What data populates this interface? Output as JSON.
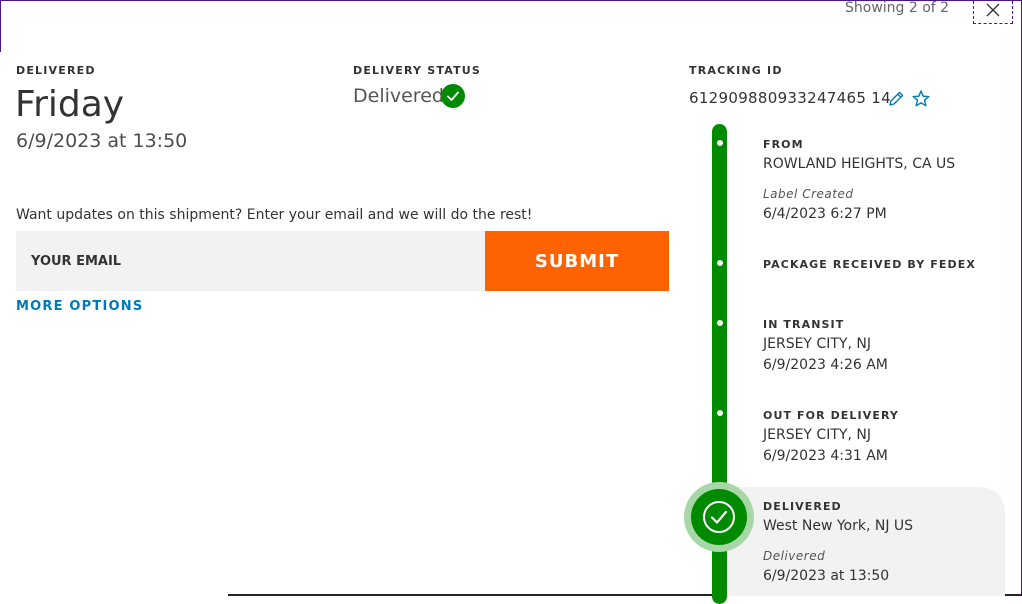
{
  "header": {
    "showing": "Showing 2 of 2",
    "close_icon": "close-icon"
  },
  "summary": {
    "delivered_label": "DELIVERED",
    "day": "Friday",
    "date_time": "6/9/2023 at 13:50",
    "status_label": "DELIVERY STATUS",
    "status_value": "Delivered",
    "tracking_label": "TRACKING ID",
    "tracking_id": "612909880933247465 14",
    "pencil_icon": "pencil-icon",
    "star_icon": "star-icon"
  },
  "email_updates": {
    "prompt": "Want updates on this shipment? Enter your email and we will do the rest!",
    "placeholder": "YOUR EMAIL",
    "submit": "SUBMIT",
    "more_options": "MORE OPTIONS"
  },
  "timeline": {
    "from": {
      "title": "FROM",
      "location": "ROWLAND HEIGHTS, CA US",
      "note": "Label Created",
      "time": "6/4/2023 6:27 PM"
    },
    "received": {
      "title": "PACKAGE RECEIVED BY FEDEX"
    },
    "in_transit": {
      "title": "IN TRANSIT",
      "location": "JERSEY CITY, NJ",
      "time": "6/9/2023 4:26 AM"
    },
    "out_for_delivery": {
      "title": "OUT FOR DELIVERY",
      "location": "JERSEY CITY, NJ",
      "time": "6/9/2023 4:31 AM"
    },
    "delivered": {
      "title": "DELIVERED",
      "location": "West New York, NJ US",
      "note": "Delivered",
      "time": "6/9/2023 at 13:50"
    }
  },
  "colors": {
    "brand_purple": "#4d148c",
    "accent_orange": "#ff6200",
    "success_green": "#008a00",
    "link_blue": "#007ab7"
  }
}
